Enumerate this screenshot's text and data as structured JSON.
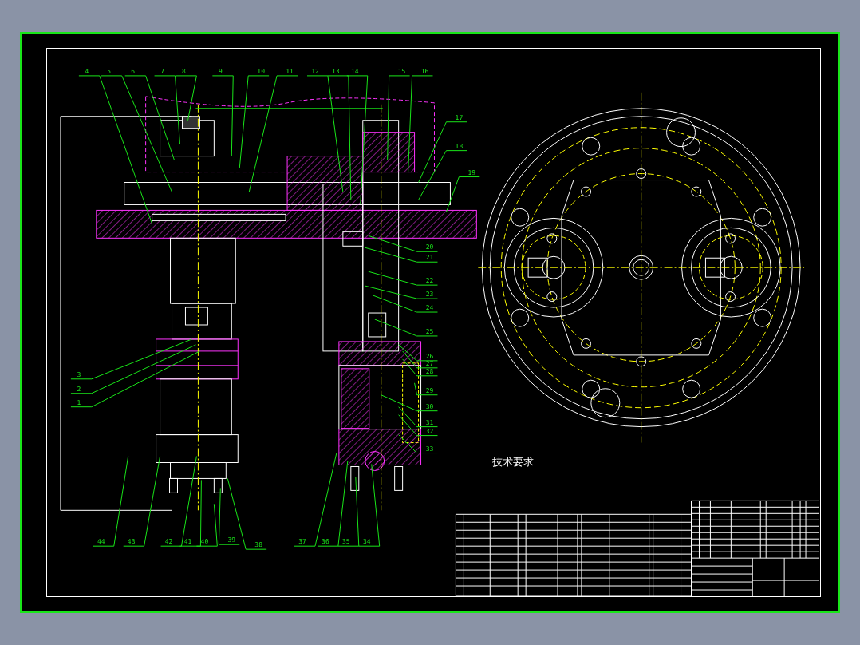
{
  "drawing": {
    "callouts": [
      "4",
      "5",
      "6",
      "7",
      "8",
      "9",
      "10",
      "11",
      "12",
      "13",
      "14",
      "15",
      "16",
      "17",
      "18",
      "19",
      "20",
      "21",
      "22",
      "23",
      "24",
      "25",
      "26",
      "27",
      "28",
      "3",
      "2",
      "29",
      "1",
      "30",
      "31",
      "32",
      "33",
      "44",
      "43",
      "42",
      "41",
      "40",
      "39",
      "38",
      "37",
      "36",
      "35",
      "34"
    ]
  },
  "notes": {
    "heading": "技术要求"
  }
}
